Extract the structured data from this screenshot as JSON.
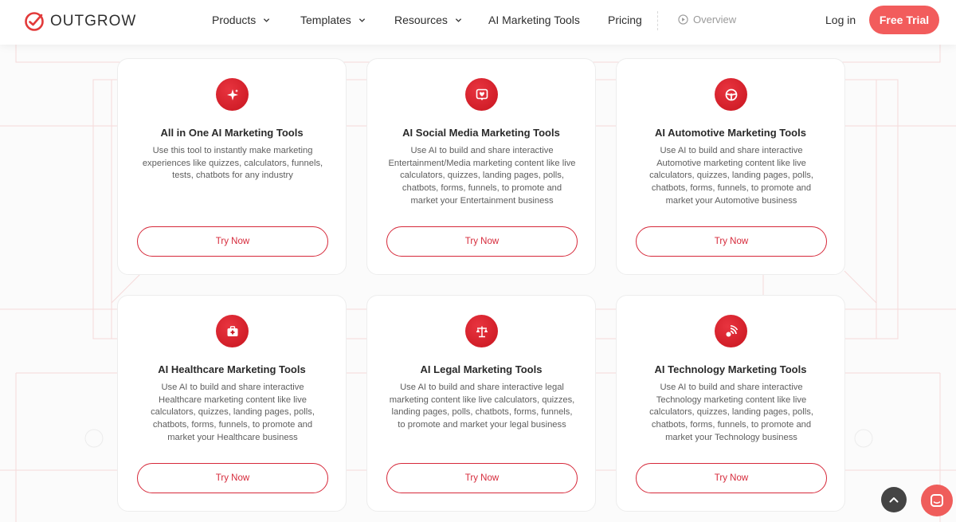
{
  "brand": {
    "name": "OUTGROW",
    "accent": "#d6293a",
    "trial_color": "#f25c5c"
  },
  "nav": {
    "products": "Products",
    "templates": "Templates",
    "resources": "Resources",
    "ai_tools": "AI Marketing Tools",
    "pricing": "Pricing",
    "overview": "Overview",
    "login": "Log in",
    "free_trial": "Free Trial"
  },
  "cards": [
    {
      "icon": "sparkles-icon",
      "title": "All in One AI Marketing Tools",
      "desc": "Use this tool to instantly make marketing experiences like quizzes, calculators, funnels, tests, chatbots for any industry",
      "button": "Try Now"
    },
    {
      "icon": "heart-chat-icon",
      "title": "AI Social Media Marketing Tools",
      "desc": "Use AI to build and share interactive Entertainment/Media marketing content like live calculators, quizzes, landing pages, polls, chatbots, forms, funnels, to promote and market your Entertainment business",
      "button": "Try Now"
    },
    {
      "icon": "steering-wheel-icon",
      "title": "AI Automotive Marketing Tools",
      "desc": "Use AI to build and share interactive Automotive marketing content like live calculators, quizzes, landing pages, polls, chatbots, forms, funnels, to promote and market your Automotive business",
      "button": "Try Now"
    },
    {
      "icon": "medical-kit-icon",
      "title": "AI Healthcare Marketing Tools",
      "desc": "Use AI to build and share interactive Healthcare marketing content like live calculators, quizzes, landing pages, polls, chatbots, forms, funnels, to promote and market your Healthcare business",
      "button": "Try Now"
    },
    {
      "icon": "scales-icon",
      "title": "AI Legal Marketing Tools",
      "desc": "Use AI to build and share interactive legal marketing content like live calculators, quizzes, landing pages, polls, chatbots, forms, funnels, to promote and market your legal business",
      "button": "Try Now"
    },
    {
      "icon": "signal-icon",
      "title": "AI Technology Marketing Tools",
      "desc": "Use AI to build and share interactive Technology marketing content like live calculators, quizzes, landing pages, polls, chatbots, forms, funnels, to promote and market your Technology business",
      "button": "Try Now"
    }
  ],
  "widgets": {
    "scroll_top": "chevron-up-icon",
    "chat": "chat-icon"
  }
}
